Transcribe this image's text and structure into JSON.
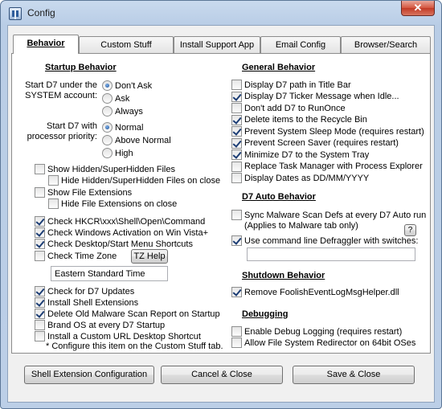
{
  "window": {
    "title": "Config",
    "close_glyph": "✕"
  },
  "tabs": [
    {
      "label": "Behavior",
      "active": true
    },
    {
      "label": "Custom Stuff",
      "active": false
    },
    {
      "label": "Install Support App",
      "active": false
    },
    {
      "label": "Email Config",
      "active": false
    },
    {
      "label": "Browser/Search",
      "active": false
    }
  ],
  "startup": {
    "title": "Startup Behavior",
    "system_label_1": "Start D7 under the",
    "system_label_2": "SYSTEM account:",
    "system_options": [
      {
        "label": "Don't Ask",
        "checked": true
      },
      {
        "label": "Ask",
        "checked": false
      },
      {
        "label": "Always",
        "checked": false
      }
    ],
    "priority_label_1": "Start D7 with",
    "priority_label_2": "processor priority:",
    "priority_options": [
      {
        "label": "Normal",
        "checked": true
      },
      {
        "label": "Above Normal",
        "checked": false
      },
      {
        "label": "High",
        "checked": false
      }
    ]
  },
  "left_checks": {
    "show_hidden": {
      "label": "Show Hidden/SuperHidden Files",
      "checked": false
    },
    "hide_hidden": {
      "label": "Hide Hidden/SuperHidden Files on close",
      "checked": false
    },
    "show_ext": {
      "label": "Show File Extensions",
      "checked": false
    },
    "hide_ext": {
      "label": "Hide File Extensions on close",
      "checked": false
    },
    "hkcr": {
      "label": "Check HKCR\\xxx\\Shell\\Open\\Command",
      "checked": true
    },
    "activation": {
      "label": "Check Windows Activation on Win Vista+",
      "checked": true
    },
    "desktop": {
      "label": "Check Desktop/Start Menu Shortcuts",
      "checked": true
    },
    "timezone": {
      "label": "Check Time Zone",
      "checked": false
    },
    "updates": {
      "label": "Check for D7 Updates",
      "checked": true
    },
    "shell_ext": {
      "label": "Install Shell Extensions",
      "checked": true
    },
    "delete_report": {
      "label": "Delete Old Malware Scan Report on Startup",
      "checked": true
    },
    "brand_os": {
      "label": "Brand OS at every D7 Startup",
      "checked": false
    },
    "custom_url": {
      "label": "Install a Custom URL Desktop Shortcut",
      "checked": false
    }
  },
  "tz_help_label": "TZ Help",
  "timezone_value": "Eastern Standard Time",
  "custom_note": "* Configure this item on the Custom Stuff tab.",
  "general": {
    "title": "General Behavior",
    "items": [
      {
        "label": "Display D7 path in Title Bar",
        "checked": false
      },
      {
        "label": "Display D7 Ticker Message when Idle...",
        "checked": true
      },
      {
        "label": "Don't add D7 to RunOnce",
        "checked": false
      },
      {
        "label": "Delete items to the Recycle Bin",
        "checked": true
      },
      {
        "label": "Prevent System Sleep Mode  (requires restart)",
        "checked": true
      },
      {
        "label": "Prevent Screen Saver (requires restart)",
        "checked": true
      },
      {
        "label": "Minimize D7 to the System Tray",
        "checked": true
      },
      {
        "label": "Replace Task Manager with Process Explorer",
        "checked": false
      },
      {
        "label": "Display Dates as DD/MM/YYYY",
        "checked": false
      }
    ]
  },
  "auto": {
    "title": "D7 Auto Behavior",
    "sync_label_1": "Sync Malware Scan Defs at every D7 Auto run",
    "sync_label_2": "(Applies to Malware tab only)",
    "sync_checked": false,
    "defrag_label": "Use command line Defraggler with switches:",
    "defrag_checked": true,
    "help_label": "?",
    "defrag_value": ""
  },
  "shutdown": {
    "title": "Shutdown Behavior",
    "remove_label": "Remove FoolishEventLogMsgHelper.dll",
    "remove_checked": true
  },
  "debugging": {
    "title": "Debugging",
    "debug_label": "Enable Debug Logging  (requires restart)",
    "debug_checked": false,
    "redirect_label": "Allow File System Redirector on 64bit OSes",
    "redirect_checked": false
  },
  "footer": {
    "shell_config": "Shell Extension Configuration",
    "cancel": "Cancel & Close",
    "save": "Save & Close"
  }
}
